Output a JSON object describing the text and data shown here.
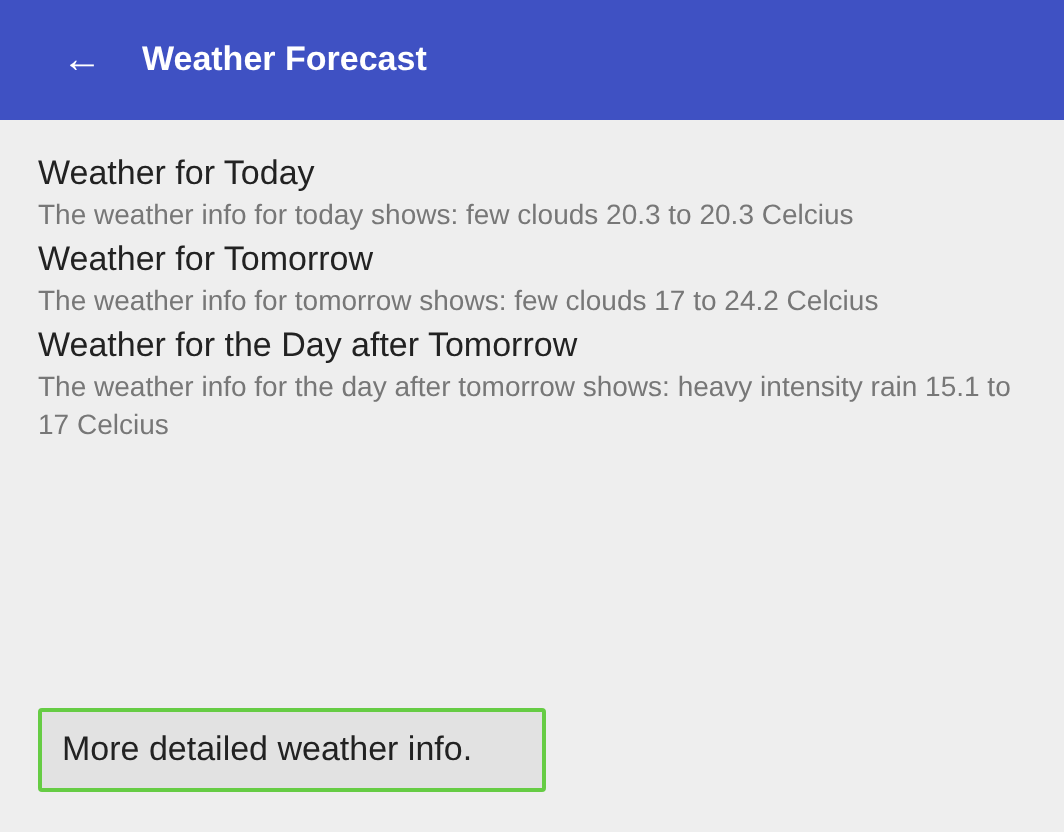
{
  "app_bar": {
    "back_icon": "←",
    "title": "Weather Forecast"
  },
  "forecasts": [
    {
      "title": "Weather for Today",
      "description": "The weather info for today shows: few clouds 20.3 to 20.3 Celcius"
    },
    {
      "title": "Weather for Tomorrow",
      "description": "The weather info for tomorrow shows: few clouds 17 to 24.2 Celcius"
    },
    {
      "title": "Weather for the Day after Tomorrow",
      "description": "The weather info for the day after tomorrow shows: heavy intensity rain 15.1 to 17 Celcius"
    }
  ],
  "button": {
    "label": "More detailed weather info.",
    "focused": true
  }
}
